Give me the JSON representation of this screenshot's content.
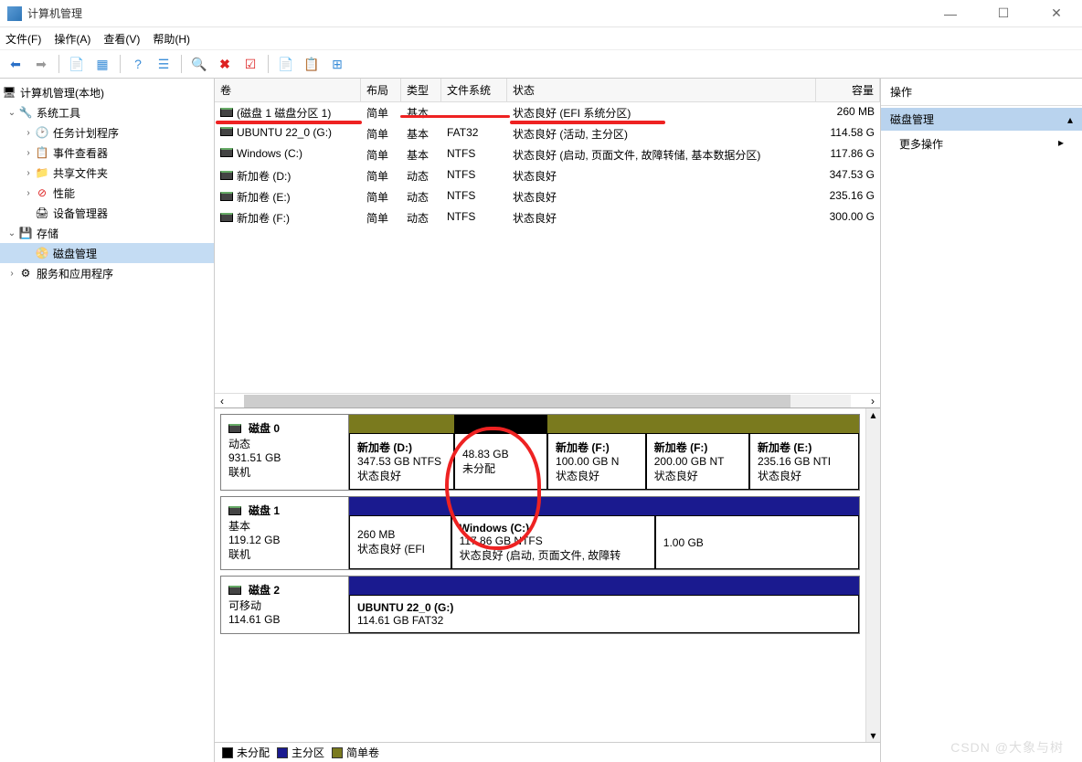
{
  "window": {
    "title": "计算机管理"
  },
  "menu": {
    "file": "文件(F)",
    "action": "操作(A)",
    "view": "查看(V)",
    "help": "帮助(H)"
  },
  "tree": {
    "root": "计算机管理(本地)",
    "sys_tools": "系统工具",
    "task_sched": "任务计划程序",
    "event_viewer": "事件查看器",
    "shared_folders": "共享文件夹",
    "performance": "性能",
    "device_mgr": "设备管理器",
    "storage": "存储",
    "disk_mgmt": "磁盘管理",
    "services": "服务和应用程序"
  },
  "table": {
    "headers": {
      "volume": "卷",
      "layout": "布局",
      "type": "类型",
      "fs": "文件系统",
      "status": "状态",
      "capacity": "容量"
    },
    "rows": [
      {
        "vol": "(磁盘 1 磁盘分区 1)",
        "layout": "简单",
        "type": "基本",
        "fs": "",
        "status": "状态良好 (EFI 系统分区)",
        "cap": "260 MB"
      },
      {
        "vol": "UBUNTU 22_0 (G:)",
        "layout": "简单",
        "type": "基本",
        "fs": "FAT32",
        "status": "状态良好 (活动, 主分区)",
        "cap": "114.58 G"
      },
      {
        "vol": "Windows (C:)",
        "layout": "简单",
        "type": "基本",
        "fs": "NTFS",
        "status": "状态良好 (启动, 页面文件, 故障转储, 基本数据分区)",
        "cap": "117.86 G"
      },
      {
        "vol": "新加卷 (D:)",
        "layout": "简单",
        "type": "动态",
        "fs": "NTFS",
        "status": "状态良好",
        "cap": "347.53 G"
      },
      {
        "vol": "新加卷 (E:)",
        "layout": "简单",
        "type": "动态",
        "fs": "NTFS",
        "status": "状态良好",
        "cap": "235.16 G"
      },
      {
        "vol": "新加卷 (F:)",
        "layout": "简单",
        "type": "动态",
        "fs": "NTFS",
        "status": "状态良好",
        "cap": "300.00 G"
      }
    ]
  },
  "disks": {
    "d0": {
      "name": "磁盘 0",
      "type": "动态",
      "size": "931.51 GB",
      "status": "联机"
    },
    "d0parts": [
      {
        "name": "新加卷  (D:)",
        "size": "347.53 GB NTFS",
        "status": "状态良好"
      },
      {
        "name": "",
        "size": "48.83 GB",
        "status": "未分配"
      },
      {
        "name": "新加卷  (F:)",
        "size": "100.00 GB N",
        "status": "状态良好"
      },
      {
        "name": "新加卷  (F:)",
        "size": "200.00 GB NT",
        "status": "状态良好"
      },
      {
        "name": "新加卷  (E:)",
        "size": "235.16 GB NTI",
        "status": "状态良好"
      }
    ],
    "d1": {
      "name": "磁盘 1",
      "type": "基本",
      "size": "119.12 GB",
      "status": "联机"
    },
    "d1parts": [
      {
        "name": "",
        "size": "260 MB",
        "status": "状态良好 (EFI"
      },
      {
        "name": "Windows  (C:)",
        "size": "117.86 GB NTFS",
        "status": "状态良好 (启动, 页面文件, 故障转"
      },
      {
        "name": "",
        "size": "1.00 GB",
        "status": ""
      }
    ],
    "d2": {
      "name": "磁盘 2",
      "type": "可移动",
      "size": "114.61 GB"
    },
    "d2parts": [
      {
        "name": "UBUNTU 22_0  (G:)",
        "size": "114.61 GB FAT32",
        "status": ""
      }
    ]
  },
  "legend": {
    "unalloc": "未分配",
    "primary": "主分区",
    "simple": "简单卷"
  },
  "actions": {
    "title": "操作",
    "selected": "磁盘管理",
    "more": "更多操作"
  },
  "watermark": "CSDN @大象与树"
}
